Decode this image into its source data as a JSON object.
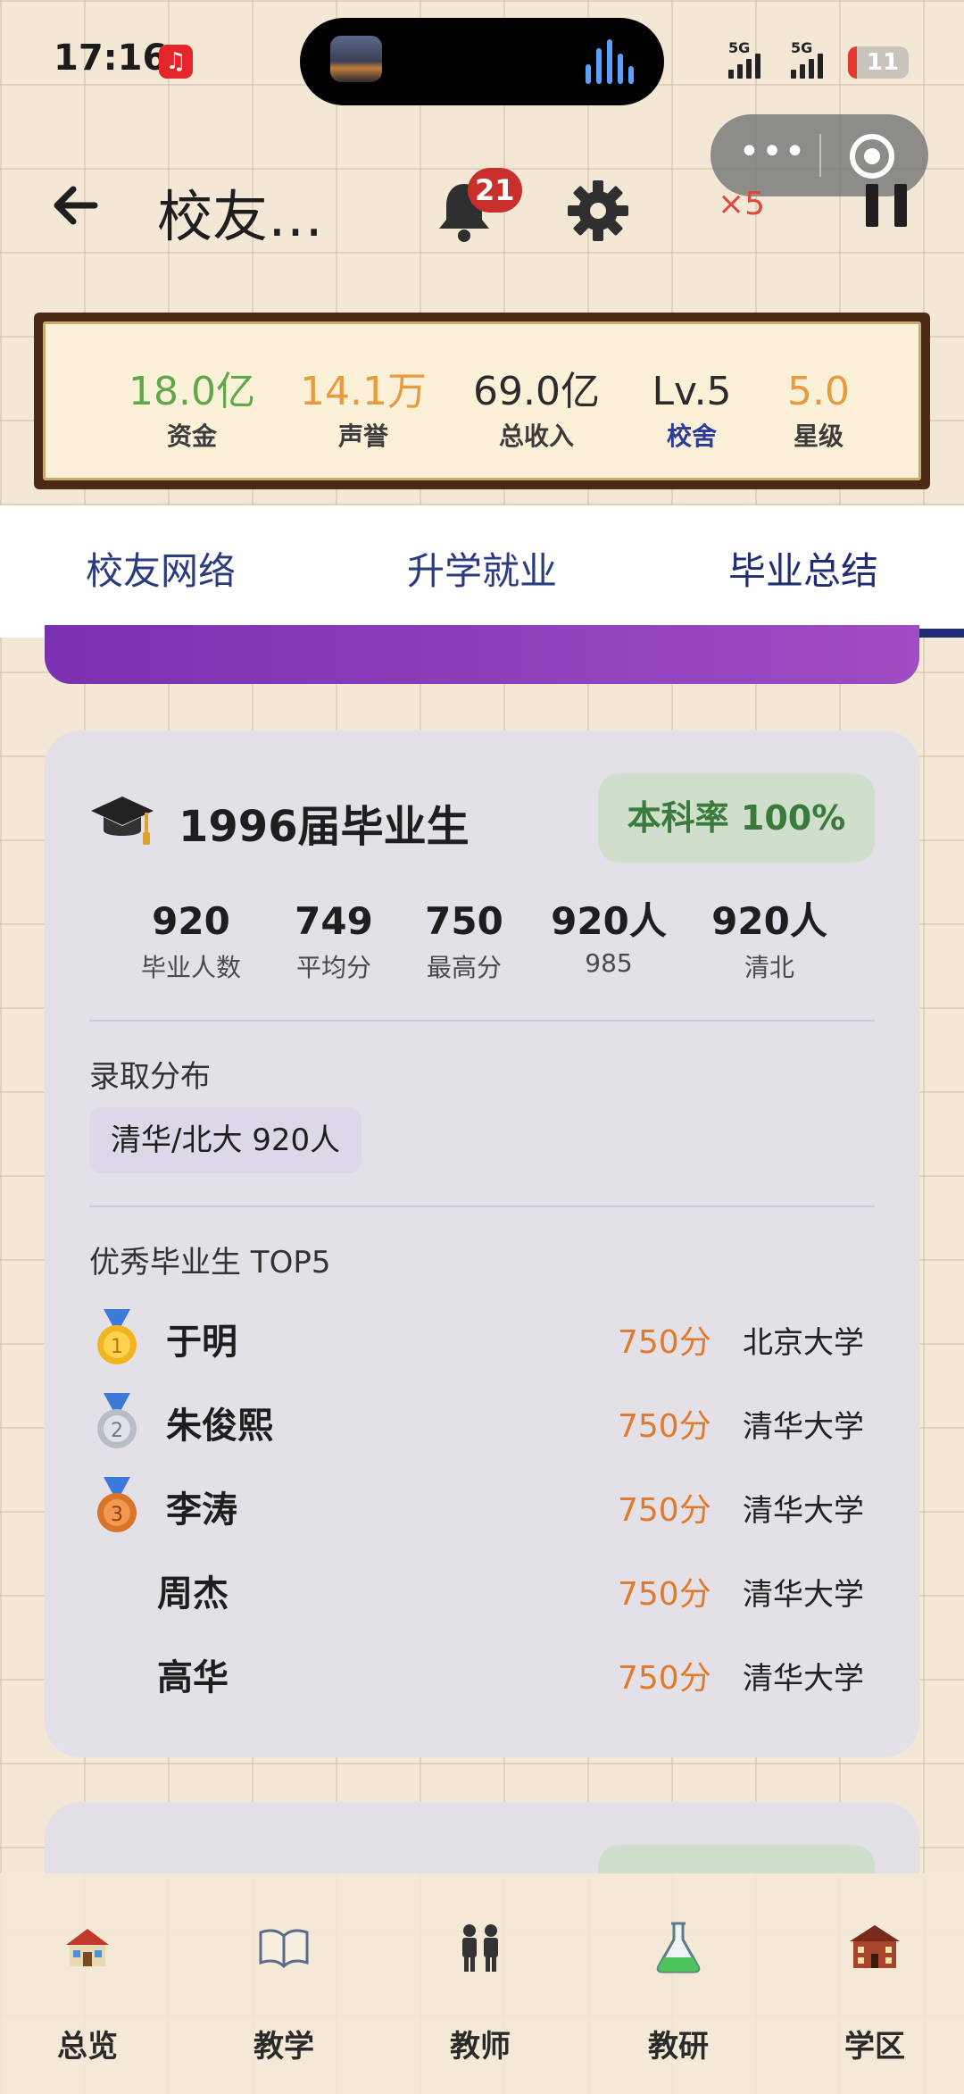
{
  "status_bar": {
    "time": "17:16",
    "signal_1": "5G",
    "signal_2": "5G",
    "battery": "11"
  },
  "header": {
    "title": "校友…",
    "notification_count": "21",
    "speed": "×5"
  },
  "stats": [
    {
      "value": "18.0亿",
      "label": "资金",
      "color": "#5fa84a"
    },
    {
      "value": "14.1万",
      "label": "声誉",
      "color": "#e89a3c"
    },
    {
      "value": "69.0亿",
      "label": "总收入",
      "color": "#2b2b2b"
    },
    {
      "value": "Lv.5",
      "label": "校舍",
      "color": "#2b2b2b",
      "label_color": "#2b3b9a"
    },
    {
      "value": "5.0",
      "label": "星级",
      "color": "#e89a3c"
    }
  ],
  "tabs": {
    "items": [
      "校友网络",
      "升学就业",
      "毕业总结"
    ],
    "active_index": 2
  },
  "card": {
    "title": "1996届毕业生",
    "rate_badge": "本科率 100%",
    "metrics": [
      {
        "value": "920",
        "label": "毕业人数"
      },
      {
        "value": "749",
        "label": "平均分"
      },
      {
        "value": "750",
        "label": "最高分"
      },
      {
        "value": "920人",
        "label": "985"
      },
      {
        "value": "920人",
        "label": "清北"
      }
    ],
    "distribution_heading": "录取分布",
    "distribution_chip": "清华/北大 920人",
    "top_heading": "优秀毕业生 TOP5",
    "top_students": [
      {
        "name": "于明",
        "score": "750分",
        "university": "北京大学",
        "medal": "gold"
      },
      {
        "name": "朱俊熙",
        "score": "750分",
        "university": "清华大学",
        "medal": "silver"
      },
      {
        "name": "李涛",
        "score": "750分",
        "university": "清华大学",
        "medal": "bronze"
      },
      {
        "name": "周杰",
        "score": "750分",
        "university": "清华大学",
        "medal": "none"
      },
      {
        "name": "高华",
        "score": "750分",
        "university": "清华大学",
        "medal": "none"
      }
    ]
  },
  "bottom_nav": [
    {
      "label": "总览",
      "icon": "school-house-icon"
    },
    {
      "label": "教学",
      "icon": "open-book-icon"
    },
    {
      "label": "教师",
      "icon": "teachers-icon"
    },
    {
      "label": "教研",
      "icon": "flask-icon"
    },
    {
      "label": "学区",
      "icon": "campus-building-icon"
    }
  ],
  "colors": {
    "accent_tab": "#1f2d72",
    "score": "#e07a2c",
    "badge_red": "#c9302c"
  }
}
